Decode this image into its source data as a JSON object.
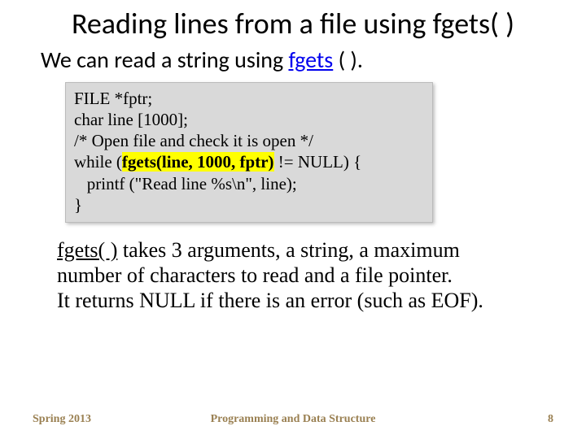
{
  "title": "Reading lines from a file using fgets( )",
  "intro_prefix": "We can read a string using ",
  "intro_link": "fgets",
  "intro_suffix": " ( ).",
  "code": {
    "l1": "FILE *fptr;",
    "l2": "char line [1000];",
    "l3": "/* Open file and check it is open */",
    "l4a": "while (",
    "l4b": "fgets(line, 1000, fptr)",
    "l4c": " != NULL) {",
    "l5": "   printf (\"Read line %s\\n\", line);",
    "l6": "}"
  },
  "desc": {
    "l1a": "fgets( )",
    "l1b": " takes 3 arguments, a string, a maximum",
    "l2": "number of characters to read and a file pointer.",
    "l3": "It returns NULL if there is an error (such as EOF)."
  },
  "footer": {
    "left": "Spring 2013",
    "center": "Programming and Data Structure",
    "right": "8"
  }
}
